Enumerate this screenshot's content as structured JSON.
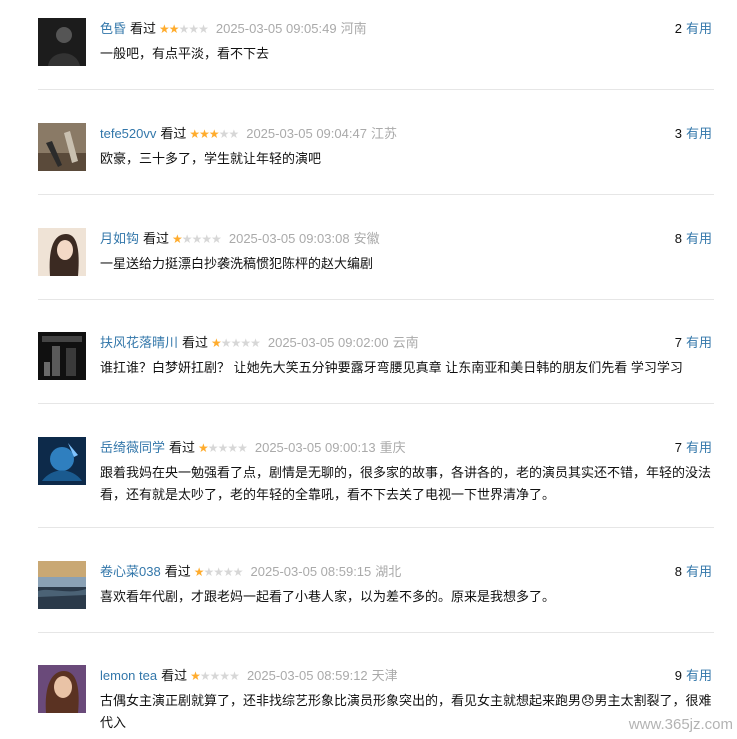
{
  "comments": [
    {
      "user": "色昏",
      "status": "看过",
      "rating": 2,
      "time": "2025-03-05 09:05:49",
      "location": "河南",
      "votes": "2",
      "vote_label": "有用",
      "text": "一般吧，有点平淡，看不下去"
    },
    {
      "user": "tefe520vv",
      "status": "看过",
      "rating": 3,
      "time": "2025-03-05 09:04:47",
      "location": "江苏",
      "votes": "3",
      "vote_label": "有用",
      "text": "欧豪，三十多了，学生就让年轻的演吧"
    },
    {
      "user": "月如钩",
      "status": "看过",
      "rating": 1,
      "time": "2025-03-05 09:03:08",
      "location": "安徽",
      "votes": "8",
      "vote_label": "有用",
      "text": "一星送给力挺漂白抄袭洗稿惯犯陈枰的赵大编剧"
    },
    {
      "user": "扶风花落晴川",
      "status": "看过",
      "rating": 1,
      "time": "2025-03-05 09:02:00",
      "location": "云南",
      "votes": "7",
      "vote_label": "有用",
      "text": "谁扛谁？白梦妍扛剧？ 让她先大笑五分钟要露牙弯腰见真章 让东南亚和美日韩的朋友们先看 学习学习"
    },
    {
      "user": "岳绮薇同学",
      "status": "看过",
      "rating": 1,
      "time": "2025-03-05 09:00:13",
      "location": "重庆",
      "votes": "7",
      "vote_label": "有用",
      "text": "跟着我妈在央一勉强看了点，剧情是无聊的，很多家的故事，各讲各的，老的演员其实还不错，年轻的没法看，还有就是太吵了，老的年轻的全靠吼，看不下去关了电视一下世界清净了。"
    },
    {
      "user": "卷心菜038",
      "status": "看过",
      "rating": 1,
      "time": "2025-03-05 08:59:15",
      "location": "湖北",
      "votes": "8",
      "vote_label": "有用",
      "text": "喜欢看年代剧，才跟老妈一起看了小巷人家，以为差不多的。原来是我想多了。"
    },
    {
      "user": "lemon tea",
      "status": "看过",
      "rating": 1,
      "time": "2025-03-05 08:59:12",
      "location": "天津",
      "votes": "9",
      "vote_label": "有用",
      "text": "古偶女主演正剧就算了，还非找综艺形象比演员形象突出的，看见女主就想起来跑男😞男主太割裂了，很难代入"
    }
  ],
  "watermark": "www.365jz.com",
  "colors": {
    "link": "#3377aa",
    "star_on": "#ffac2d",
    "star_off": "#d7d7d7",
    "muted": "#aaaaaa"
  }
}
